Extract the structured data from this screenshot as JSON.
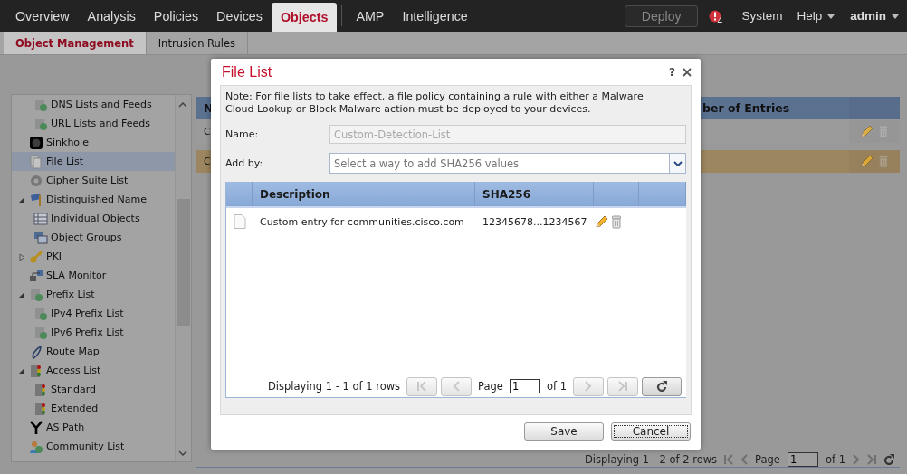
{
  "nav": {
    "tabs": [
      {
        "label": "Overview",
        "selected": false
      },
      {
        "label": "Analysis",
        "selected": false
      },
      {
        "label": "Policies",
        "selected": false
      },
      {
        "label": "Devices",
        "selected": false
      },
      {
        "label": "Objects",
        "selected": true
      },
      {
        "label": "AMP",
        "selected": false
      },
      {
        "label": "Intelligence",
        "selected": false
      }
    ],
    "deploy": "Deploy",
    "alert_count": "4",
    "menus": [
      {
        "label": "System",
        "dropdown": false
      },
      {
        "label": "Help",
        "dropdown": true
      },
      {
        "label": "admin",
        "dropdown": true
      }
    ]
  },
  "subtabs": [
    {
      "label": "Object Management",
      "selected": true
    },
    {
      "label": "Intrusion Rules",
      "selected": false
    }
  ],
  "sidebar": {
    "items": [
      {
        "children": [
          {
            "label": "DNS Lists and Feeds",
            "selected": false
          },
          {
            "label": "URL Lists and Feeds",
            "selected": false
          }
        ]
      },
      {
        "label": "Sinkhole",
        "selected": false
      },
      {
        "label": "File List",
        "selected": true
      },
      {
        "label": "Cipher Suite List",
        "selected": false
      },
      {
        "label": "Distinguished Name",
        "selected": false,
        "expanded": true,
        "children": [
          {
            "label": "Individual Objects",
            "selected": false
          },
          {
            "label": "Object Groups",
            "selected": false
          }
        ]
      },
      {
        "label": "PKI",
        "selected": false,
        "expanded": false
      },
      {
        "label": "SLA Monitor",
        "selected": false
      },
      {
        "label": "Prefix List",
        "selected": false,
        "expanded": true,
        "children": [
          {
            "label": "IPv4 Prefix List",
            "selected": false
          },
          {
            "label": "IPv6 Prefix List",
            "selected": false
          }
        ]
      },
      {
        "label": "Route Map",
        "selected": false
      },
      {
        "label": "Access List",
        "selected": false,
        "expanded": true,
        "children": [
          {
            "label": "Standard",
            "selected": false
          },
          {
            "label": "Extended",
            "selected": false
          }
        ]
      },
      {
        "label": "AS Path",
        "selected": false
      },
      {
        "label": "Community List",
        "selected": false
      }
    ]
  },
  "table": {
    "columns": [
      "N",
      "ber of Entries"
    ],
    "rows": [
      {
        "column_1": "C",
        "selected": false
      },
      {
        "column_1": "C",
        "selected": true
      }
    ],
    "footer": {
      "summary": "Displaying 1 - 2 of 2 rows",
      "page_label": "Page",
      "page": "1",
      "of": "of 1"
    }
  },
  "dialog": {
    "title": "File List",
    "help": "?",
    "note": "Note: For file lists to take effect, a file policy containing a rule with either a Malware Cloud Lookup or Block Malware action must be deployed to your devices.",
    "name_label": "Name:",
    "name_value": "Custom-Detection-List",
    "name_disabled": true,
    "addby_label": "Add by:",
    "addby_placeholder": "Select a way to add SHA256 values",
    "grid": {
      "columns": [
        "Description",
        "SHA256"
      ],
      "rows": [
        {
          "description": "Custom entry for communities.cisco.com",
          "sha256": "12345678...1234567"
        }
      ],
      "footer": {
        "summary": "Displaying 1 - 1 of 1 rows",
        "page_label": "Page",
        "page": "1",
        "of": "of 1",
        "buttons": [
          {
            "kind": "first",
            "disabled": true
          },
          {
            "kind": "prev",
            "disabled": true
          },
          {
            "kind": "next",
            "disabled": true
          },
          {
            "kind": "last",
            "disabled": true
          },
          {
            "kind": "refresh",
            "disabled": false
          }
        ]
      }
    },
    "buttons": [
      "Save",
      "Cancel"
    ]
  }
}
